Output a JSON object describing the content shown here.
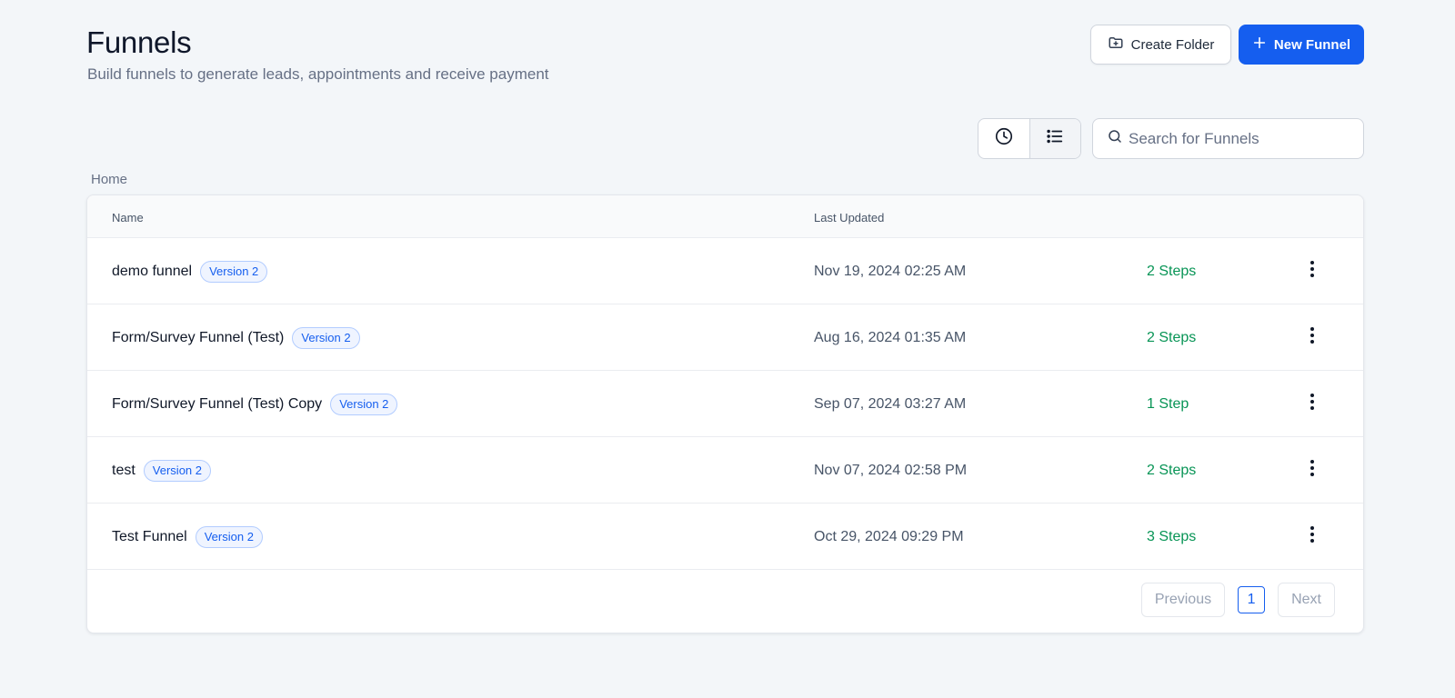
{
  "header": {
    "title": "Funnels",
    "subtitle": "Build funnels to generate leads, appointments and receive payment",
    "create_folder_label": "Create Folder",
    "new_funnel_label": "New Funnel"
  },
  "toolbar": {
    "view_icons": [
      "clock-icon",
      "list-icon"
    ],
    "search_placeholder": "Search for Funnels"
  },
  "breadcrumb": "Home",
  "table": {
    "columns": [
      "Name",
      "Last Updated"
    ],
    "rows": [
      {
        "name": "demo funnel",
        "badge": "Version 2",
        "updated": "Nov 19, 2024 02:25 AM",
        "steps": "2 Steps"
      },
      {
        "name": "Form/Survey Funnel (Test)",
        "badge": "Version 2",
        "updated": "Aug 16, 2024 01:35 AM",
        "steps": "2 Steps"
      },
      {
        "name": "Form/Survey Funnel (Test) Copy",
        "badge": "Version 2",
        "updated": "Sep 07, 2024 03:27 AM",
        "steps": "1 Step"
      },
      {
        "name": "test",
        "badge": "Version 2",
        "updated": "Nov 07, 2024 02:58 PM",
        "steps": "2 Steps"
      },
      {
        "name": "Test Funnel",
        "badge": "Version 2",
        "updated": "Oct 29, 2024 09:29 PM",
        "steps": "3 Steps"
      }
    ]
  },
  "pagination": {
    "previous_label": "Previous",
    "current_page": "1",
    "next_label": "Next"
  },
  "colors": {
    "primary": "#155eef",
    "steps_green": "#079455",
    "background": "#f3f6f9"
  }
}
